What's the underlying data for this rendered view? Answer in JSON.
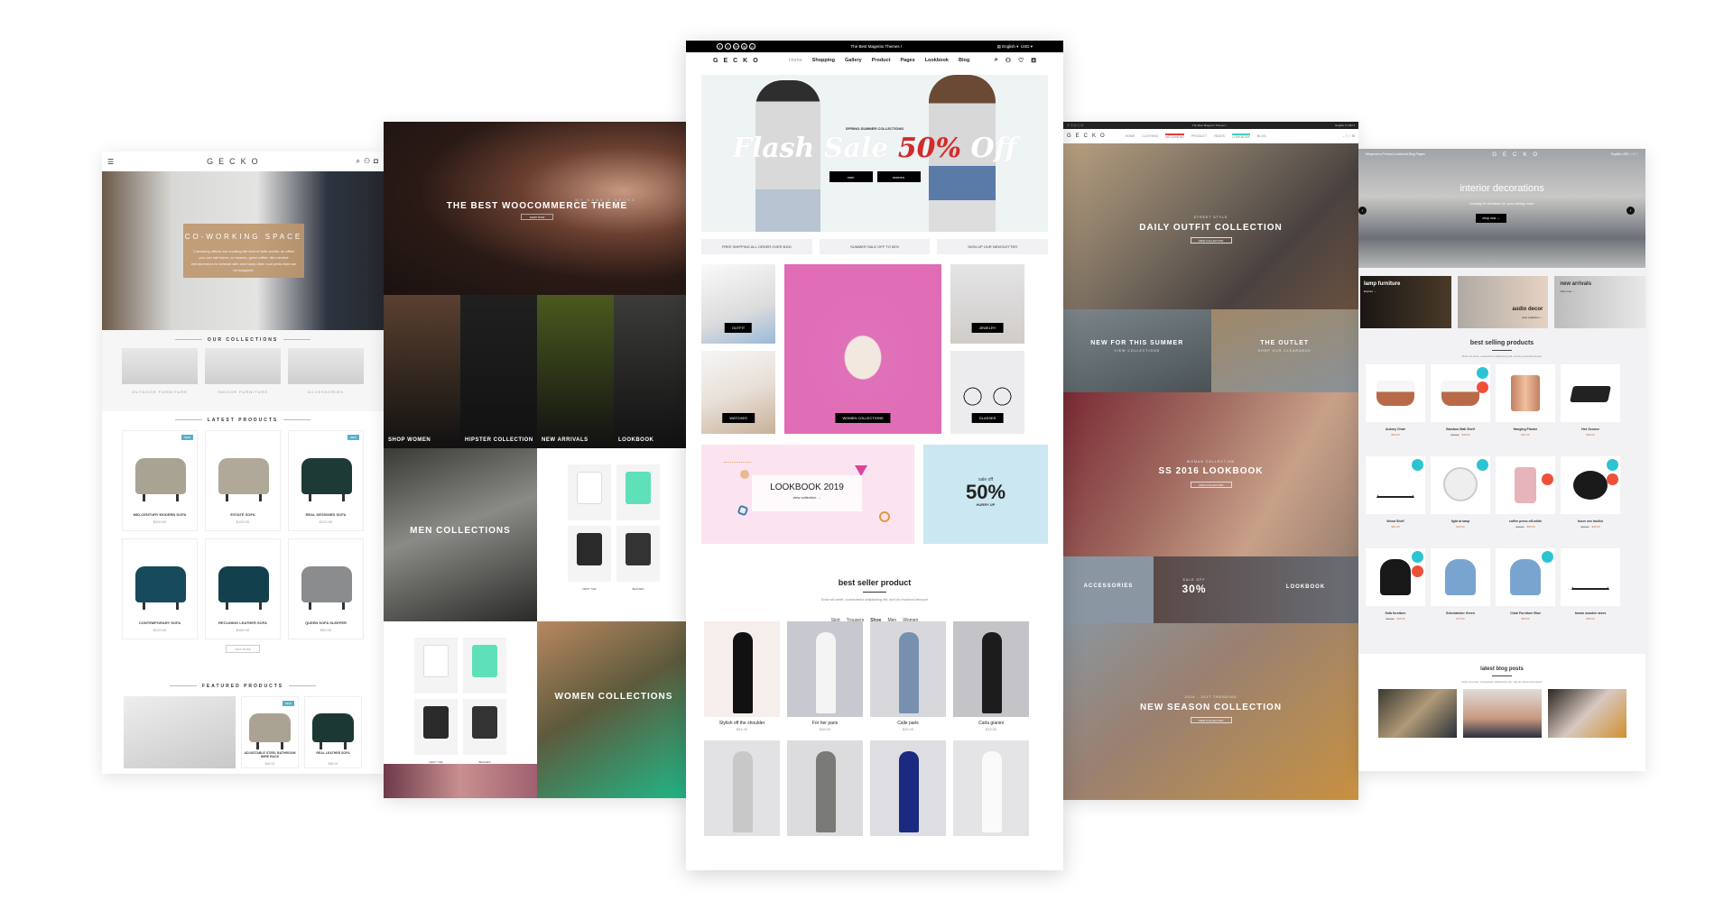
{
  "panel_furniture": {
    "logo": "GECKO",
    "hero": {
      "title": "CO-WORKING SPACE",
      "description": "Coworking offices are creating the best of both worlds: an office you can call home, no bosses, great coffee, like-minded entrepreneurs to network with and many other cool perks that can be imagined."
    },
    "collections": {
      "title": "OUR COLLECTIONS",
      "items": [
        "OUTDOOR FURNITURE",
        "INDOOR FURNITURE",
        "ACCESSORIES"
      ]
    },
    "latest": {
      "title": "LATEST PRODUCTS",
      "products": [
        {
          "name": "MID-CENTURY MODERN SOFA",
          "price": "$200.00",
          "badge": "NEW",
          "color": "#a9a394"
        },
        {
          "name": "ESTATE SOFA",
          "price": "$150.00",
          "badge": "",
          "color": "#b0a898"
        },
        {
          "name": "REAL DESIGNED SOFA",
          "price": "$120.00",
          "badge": "NEW",
          "color": "#1e3a36"
        },
        {
          "name": "CONTEMPORARY SOFA",
          "price": "$220.00",
          "badge": "",
          "color": "#164a5c"
        },
        {
          "name": "RECLINING LEATHER SOFA",
          "price": "$180.00",
          "badge": "",
          "color": "#12404c"
        },
        {
          "name": "QUEEN SOFA SLEEPER",
          "price": "$90.00",
          "badge": "",
          "color": "#8a8c8e"
        }
      ],
      "view_more": "VIEW MORE"
    },
    "featured": {
      "title": "FEATURED PRODUCTS",
      "products": [
        {
          "name": "ADJUSTABLE STEEL BATHROOM WIRE RACK",
          "price": "$40.00",
          "badge": "NEW",
          "color": "#aaa394"
        },
        {
          "name": "REAL LEATHER SOFA",
          "price": "$95.00",
          "badge": "",
          "color": "#1c3834"
        }
      ]
    }
  },
  "panel_woo": {
    "hero": {
      "eyebrow": "MY NAME'S GECKO",
      "title": "THE BEST WOOCOMMERCE THEME",
      "button": "SHOP NOW"
    },
    "tiles": [
      {
        "label": "SHOP WOMEN",
        "color": "#5a4030"
      },
      {
        "label": "HIPSTER COLLECTION",
        "color": "#202020"
      },
      {
        "label": "NEW ARRIVALS",
        "color": "#4a5a1e"
      },
      {
        "label": "LOOKBOOK",
        "color": "#3c3c3a"
      }
    ],
    "men_label": "MEN COLLECTIONS",
    "women_label": "WOMEN COLLECTIONS",
    "shop_items": [
      {
        "name": "DEMY TEE",
        "color": "#ffffff"
      },
      {
        "name": "DEMY TEE",
        "color": "#5ee0b8"
      },
      {
        "name": "DEMY TEE",
        "color": "#2a2a2a"
      },
      {
        "name": "BEANIES",
        "color": "#333333"
      }
    ]
  },
  "panel_main": {
    "topbar": {
      "social": [
        "f",
        "t",
        "G+",
        "ig",
        "p"
      ],
      "tagline": "The Best Magento Themes !",
      "language": "English",
      "currency": "USD"
    },
    "nav": {
      "logo": "GECKO",
      "links": [
        "Home",
        "Shopping",
        "Gallery",
        "Product",
        "Pages",
        "Lookbook",
        "Blog"
      ]
    },
    "hero": {
      "eyebrow": "SPRING-SUMMER COLLECTIONS",
      "title_a": "Flash Sale ",
      "title_b": "50%",
      "title_c": " Off",
      "btn_men": "men",
      "btn_women": "women"
    },
    "promos": [
      "FREE SHIPPING ALL ORDER OVER $100",
      "SUMMER SALE OFF TO 50%",
      "SIGN UP OUR NEWSLETTER"
    ],
    "categories": [
      "OUTFIT",
      "WATCHES",
      "WOMEN COLLECTIONS",
      "JEWELRY",
      "GLASSES"
    ],
    "lookbook": {
      "title": "LOOKBOOK 2019",
      "link": "view collection →"
    },
    "sale": {
      "eyebrow": "sale off",
      "value": "50%",
      "cta": "HURRY UP"
    },
    "best_seller": {
      "title": "best seller product",
      "description": "Dolor sit amet, consectetur adipisicing elit, sed do eiusmod tempor!",
      "tabs": [
        "Skirt",
        "Trousers",
        "Shoe",
        "Men",
        "Women"
      ],
      "active_tab": "Shoe",
      "products": [
        {
          "name": "Stylish off the shoulder",
          "price": "$54.00",
          "bg": "#f6eeea",
          "fig": "#111111"
        },
        {
          "name": "For her paris",
          "price": "$45.00",
          "bg": "#c8c8d0",
          "fig": "#f4f4f4"
        },
        {
          "name": "Calle paris",
          "price": "$45.00",
          "bg": "#d8d8dc",
          "fig": "#7890b0"
        },
        {
          "name": "Carla gianini",
          "price": "$33.00",
          "bg": "#c4c4c8",
          "fig": "#1c1c1c"
        },
        {
          "name": "",
          "price": "",
          "bg": "#e2e2e4",
          "fig": "#c8c8c8"
        },
        {
          "name": "",
          "price": "",
          "bg": "#dcdcde",
          "fig": "#7a7a78"
        },
        {
          "name": "",
          "price": "",
          "bg": "#dedee2",
          "fig": "#1a2a80"
        },
        {
          "name": "",
          "price": "",
          "bg": "#e4e4e6",
          "fig": "#fafafa"
        }
      ]
    }
  },
  "panel_photo": {
    "topbar_tagline": "The Best Magento Themes !",
    "nav": {
      "logo": "GECKO",
      "links": [
        "HOME",
        "CLOTHING",
        "MEGAMENU",
        "PRODUCT",
        "PAGES",
        "LOOKBOOK",
        "BLOG"
      ]
    },
    "sections": [
      {
        "eyebrow": "STREET STYLE",
        "title": "DAILY OUTFIT COLLECTION",
        "button": "VIEW COLLECTION"
      },
      {
        "title_left": "NEW FOR THIS SUMMER",
        "sub_left": "VIEW COLLECTIONS",
        "title_right": "THE OUTLET",
        "sub_right": "SHOP OUR CLEARANCE"
      },
      {
        "eyebrow": "WOMAN COLLECTION",
        "title": "SS 2016 LOOKBOOK",
        "button": "VIEW COLLECTION"
      },
      {
        "left": "ACCESSORIES",
        "mid_eyebrow": "SALE OFF",
        "mid_value": "30%",
        "right": "LOOKBOOK"
      },
      {
        "eyebrow": "2016 - 2017 TRENDING",
        "title": "NEW SEASON COLLECTION",
        "button": "VIEW COLLECTION"
      }
    ]
  },
  "panel_interior": {
    "nav": {
      "links": "Megamenu  Product  Lookbook  Blog  Pages",
      "logo": "GECKO",
      "right": "English  USD"
    },
    "hero": {
      "title": "interior decorations",
      "subtitle": "looking for furniture for your dining room",
      "button": "shop now →"
    },
    "categories": [
      {
        "title": "lamp furniture",
        "sub": "Explore →"
      },
      {
        "title": "audio decor",
        "sub": "view collection →"
      },
      {
        "title": "new arrivals",
        "sub": "shop now →"
      }
    ],
    "best": {
      "title": "best selling products",
      "description": "Dolor sit amet, consectetur adipisicing elit, sed do eiusmod tempor",
      "products": [
        {
          "name": "Aubrey Chair",
          "old": "",
          "price": "$50.00",
          "b1": false,
          "b2": false,
          "shape": "bowl"
        },
        {
          "name": "Bamboo Wall Shelf",
          "old": "$60.00",
          "price": "$48.00",
          "b1": true,
          "b2": true,
          "shape": "bowl"
        },
        {
          "name": "Hanging Planter",
          "old": "",
          "price": "$67.00",
          "b1": false,
          "b2": false,
          "shape": "planter"
        },
        {
          "name": "Hex Sconce",
          "old": "",
          "price": "$90.00",
          "b1": false,
          "b2": false,
          "shape": "pan"
        },
        {
          "name": "Wood Shelf",
          "old": "",
          "price": "$61.00",
          "b1": true,
          "b2": false,
          "shape": "stand"
        },
        {
          "name": "light at lamp",
          "old": "",
          "price": "$20.00",
          "b1": true,
          "b2": false,
          "shape": "clock"
        },
        {
          "name": "coffee press off-white",
          "old": "$70.00",
          "price": "$50.00",
          "b1": false,
          "b2": true,
          "shape": "jug"
        },
        {
          "name": "fusce nec facilisi",
          "old": "$60.00",
          "price": "$45.00",
          "b1": true,
          "b2": true,
          "shape": "dish"
        },
        {
          "name": "Sofa furniture",
          "old": "$60.00",
          "price": "$45.00",
          "b1": true,
          "b2": true,
          "shape": "black-chair"
        },
        {
          "name": "Selectamber Green",
          "old": "",
          "price": "$70.00",
          "b1": false,
          "b2": false,
          "shape": "blue-chair"
        },
        {
          "name": "Chair Furniture Blue",
          "old": "",
          "price": "$65.00",
          "b1": true,
          "b2": false,
          "shape": "blue-chair"
        },
        {
          "name": "brown wooden stees",
          "old": "",
          "price": "$55.00",
          "b1": false,
          "b2": false,
          "shape": "stand"
        }
      ]
    },
    "blog": {
      "title": "latest blog posts",
      "description": "Dolor sit amet, consectetur adipisicing elit, sed do eiusmod tempor!"
    }
  }
}
